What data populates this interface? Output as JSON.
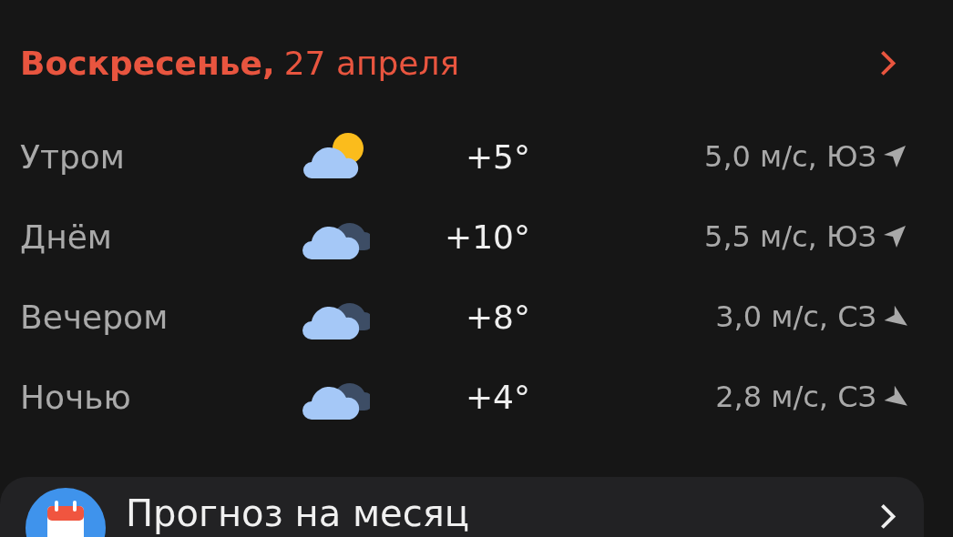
{
  "day": {
    "weekday": "Воскресенье,",
    "date": "27 апреля"
  },
  "periods": [
    {
      "label": "Утром",
      "kind": "sunny",
      "temp": "+5°",
      "wind": {
        "text": "5,0 м/с, ЮЗ",
        "kind": "southwest"
      }
    },
    {
      "label": "Днём",
      "kind": "cloudy",
      "temp": "+10°",
      "wind": {
        "text": "5,5 м/с, ЮЗ",
        "kind": "southwest"
      }
    },
    {
      "label": "Вечером",
      "kind": "cloudy",
      "temp": "+8°",
      "wind": {
        "text": "3,0 м/с, СЗ",
        "kind": "northwest"
      }
    },
    {
      "label": "Ночью",
      "kind": "cloudy",
      "temp": "+4°",
      "wind": {
        "text": "2,8 м/с, СЗ",
        "kind": "northwest"
      }
    }
  ],
  "month_card": {
    "title": "Прогноз на месяц"
  }
}
